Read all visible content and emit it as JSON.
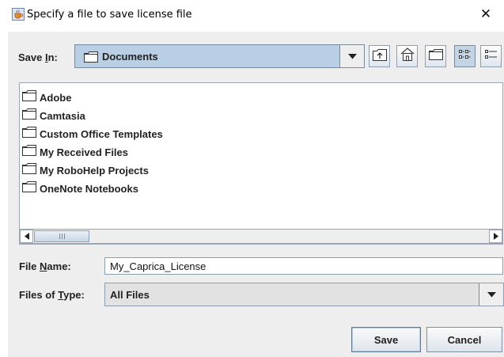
{
  "window": {
    "title": "Specify a file to save license file",
    "icon": "java-cup-icon",
    "close_glyph": "✕"
  },
  "save_in": {
    "label_before": "Save ",
    "label_mnemonic": "I",
    "label_after": "n:",
    "value": "Documents",
    "options_icon": "chevron-down-icon"
  },
  "toolbar": {
    "buttons": [
      "up-one-level-icon",
      "home-icon",
      "new-folder-icon",
      "list-view-icon",
      "details-view-icon"
    ],
    "selected": "list-view-icon"
  },
  "files": [
    {
      "name": "Adobe",
      "icon": "folder-icon"
    },
    {
      "name": "Camtasia",
      "icon": "folder-icon"
    },
    {
      "name": "Custom Office Templates",
      "icon": "folder-icon"
    },
    {
      "name": "My Received Files",
      "icon": "folder-icon"
    },
    {
      "name": "My RoboHelp Projects",
      "icon": "folder-icon"
    },
    {
      "name": "OneNote Notebooks",
      "icon": "folder-icon"
    }
  ],
  "file_name": {
    "label_before": "File ",
    "label_mnemonic": "N",
    "label_after": "ame:",
    "value": "My_Caprica_License"
  },
  "file_type": {
    "label_before": "Files of ",
    "label_mnemonic": "T",
    "label_after": "ype:",
    "value": "All Files"
  },
  "buttons": {
    "save": "Save",
    "cancel": "Cancel"
  },
  "colors": {
    "selected_combo": "#b8cfe5",
    "panel": "#eeeeee"
  }
}
